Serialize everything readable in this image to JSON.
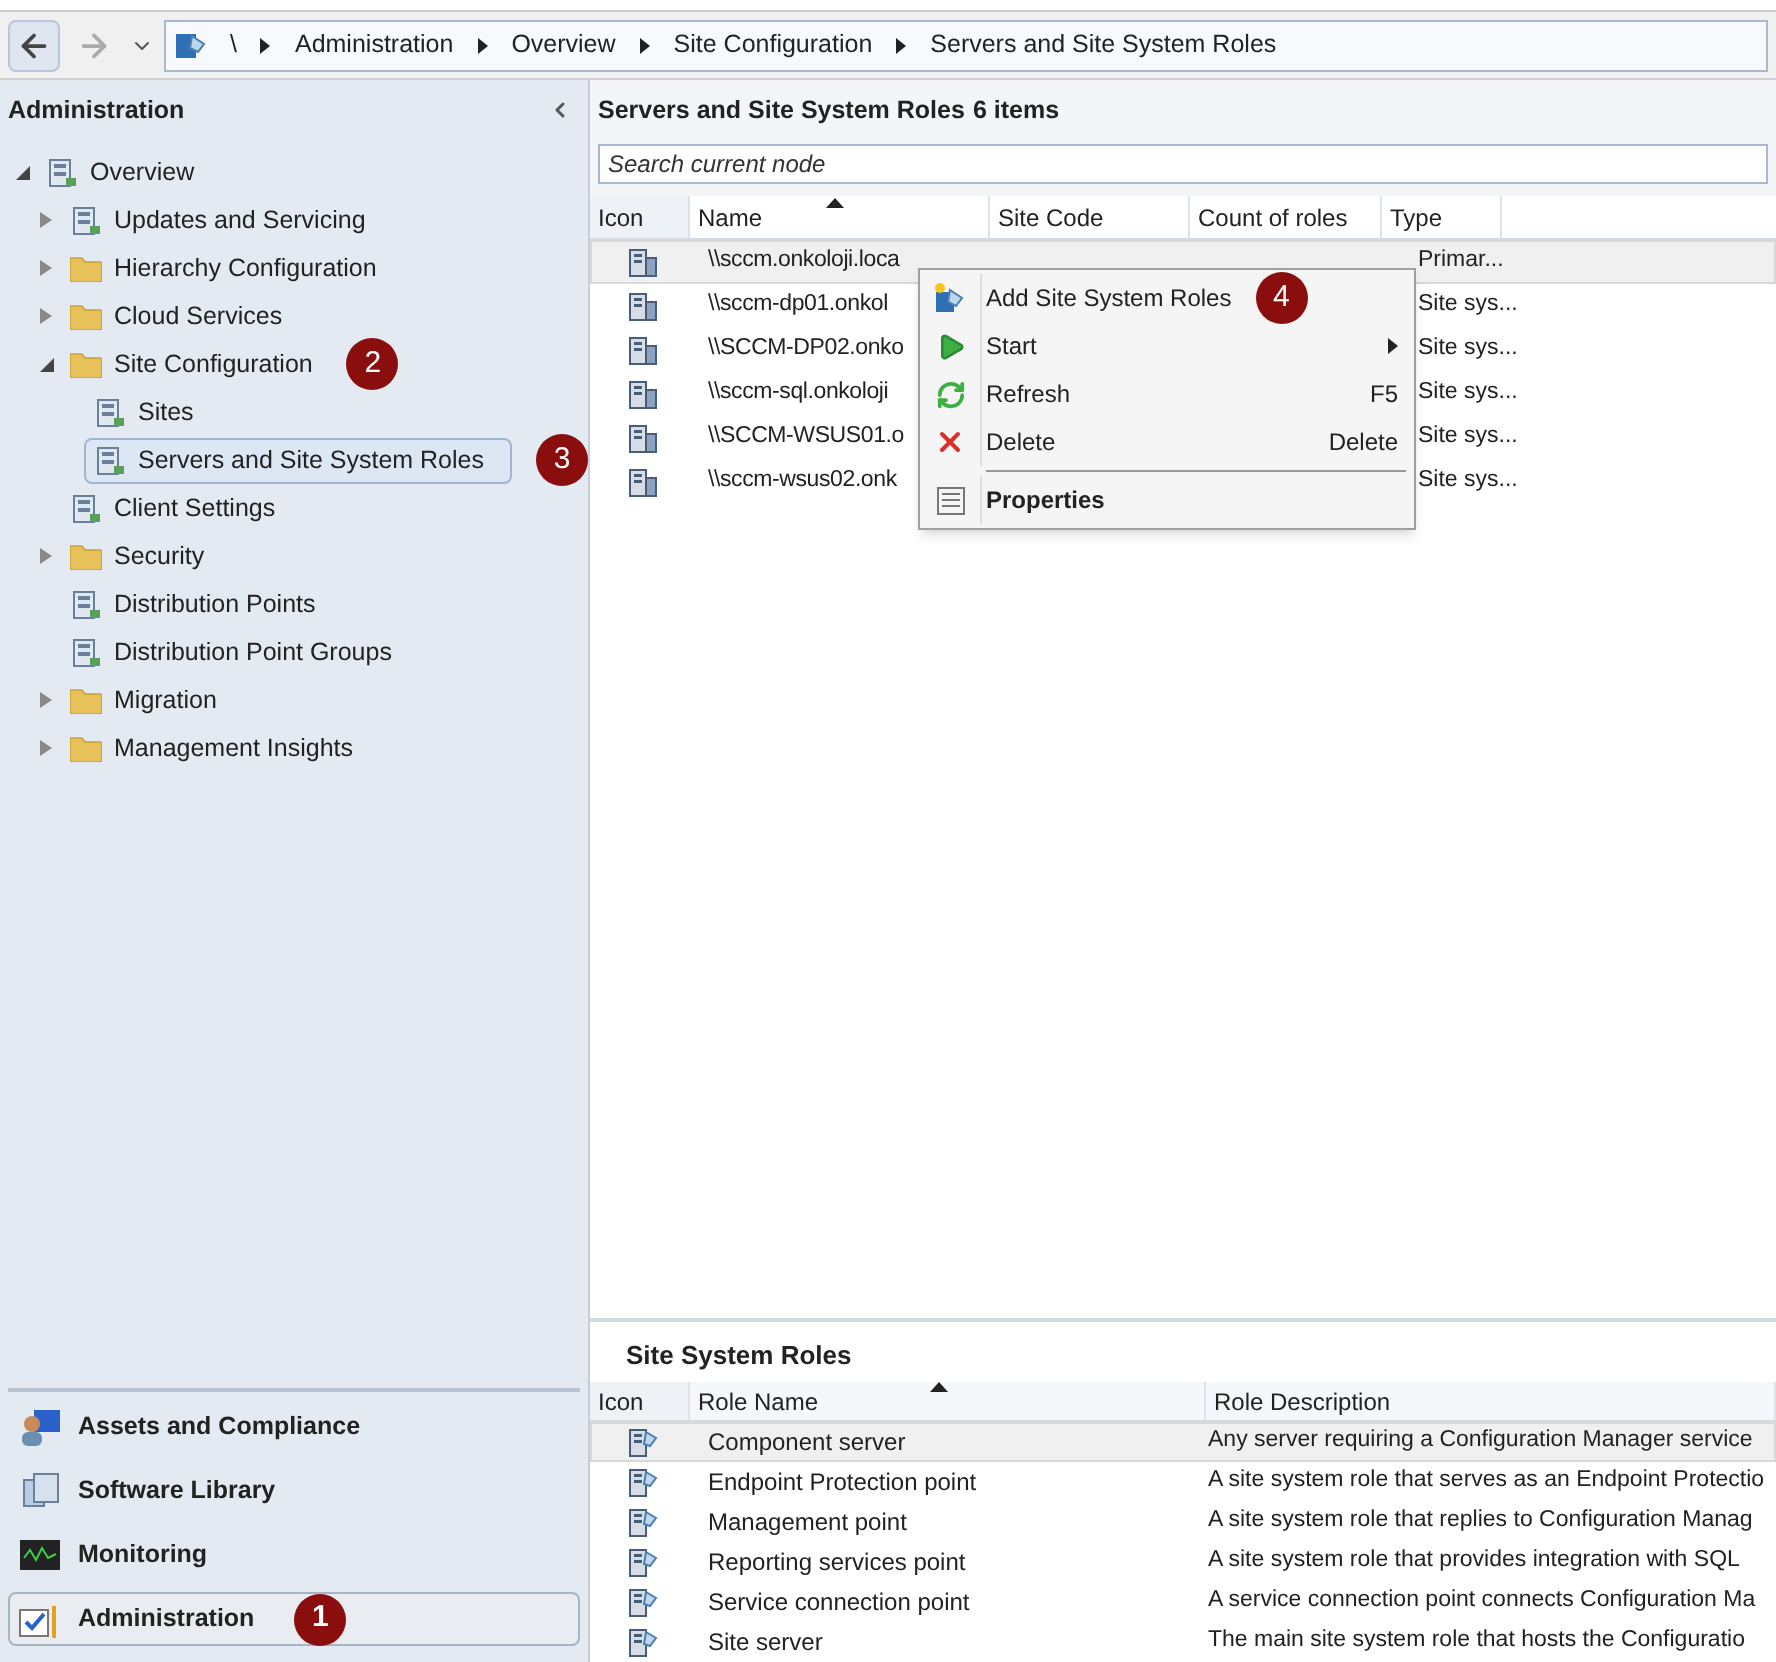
{
  "breadcrumb": [
    "\\",
    "Administration",
    "Overview",
    "Site Configuration",
    "Servers and Site System Roles"
  ],
  "navigation": {
    "title": "Administration",
    "tree": [
      {
        "label": "Overview",
        "kind": "node",
        "expanded": true,
        "selected": false,
        "children": [
          {
            "label": "Updates and Servicing",
            "kind": "node",
            "expanded": false,
            "selected": false
          },
          {
            "label": "Hierarchy Configuration",
            "kind": "folder",
            "expanded": false,
            "selected": false
          },
          {
            "label": "Cloud Services",
            "kind": "folder",
            "expanded": false,
            "selected": false
          },
          {
            "label": "Site Configuration",
            "kind": "folder",
            "expanded": true,
            "selected": false,
            "callout": "2",
            "children": [
              {
                "label": "Sites",
                "kind": "node",
                "selected": false
              },
              {
                "label": "Servers and Site System Roles",
                "kind": "node",
                "selected": true,
                "callout": "3"
              }
            ]
          },
          {
            "label": "Client Settings",
            "kind": "node",
            "selected": false
          },
          {
            "label": "Security",
            "kind": "folder",
            "expanded": false,
            "selected": false
          },
          {
            "label": "Distribution Points",
            "kind": "node",
            "selected": false
          },
          {
            "label": "Distribution Point Groups",
            "kind": "node",
            "selected": false
          },
          {
            "label": "Migration",
            "kind": "folder",
            "expanded": false,
            "selected": false
          },
          {
            "label": "Management Insights",
            "kind": "folder",
            "expanded": false,
            "selected": false
          }
        ]
      }
    ],
    "workspaces": [
      {
        "label": "Assets and Compliance",
        "selected": false
      },
      {
        "label": "Software Library",
        "selected": false
      },
      {
        "label": "Monitoring",
        "selected": false
      },
      {
        "label": "Administration",
        "selected": true,
        "callout": "1"
      }
    ]
  },
  "servers": {
    "title": "Servers and Site System Roles",
    "count": "6 items",
    "search": {
      "placeholder": "Search current node"
    },
    "columns": [
      "Icon",
      "Name",
      "Site Code",
      "Count of roles",
      "Type"
    ],
    "rows": [
      {
        "name": "\\\\sccm.onkoloji.loca",
        "type": "Primar...",
        "selected": true
      },
      {
        "name": "\\\\sccm-dp01.onkol",
        "type": "Site sys...",
        "selected": false
      },
      {
        "name": "\\\\SCCM-DP02.onko",
        "type": "Site sys...",
        "selected": false
      },
      {
        "name": "\\\\sccm-sql.onkoloji",
        "type": "Site sys...",
        "selected": false
      },
      {
        "name": "\\\\SCCM-WSUS01.o",
        "type": "Site sys...",
        "selected": false
      },
      {
        "name": "\\\\sccm-wsus02.onk",
        "type": "Site sys...",
        "selected": false
      }
    ]
  },
  "context_menu": {
    "callout": "4",
    "items": [
      {
        "kind": "item",
        "label": "Add Site System Roles",
        "bold": false,
        "submenu": false
      },
      {
        "kind": "item",
        "label": "Start",
        "bold": false,
        "submenu": true
      },
      {
        "kind": "item",
        "label": "Refresh",
        "shortcut": "F5",
        "bold": false,
        "submenu": false
      },
      {
        "kind": "item",
        "label": "Delete",
        "shortcut": "Delete",
        "bold": false,
        "submenu": false
      },
      {
        "kind": "separator"
      },
      {
        "kind": "item",
        "label": "Properties",
        "bold": true,
        "submenu": false
      }
    ]
  },
  "roles": {
    "title": "Site System Roles",
    "columns": [
      "Icon",
      "Role Name",
      "Role Description"
    ],
    "rows": [
      {
        "name": "Component server",
        "description": "Any server requiring a Configuration Manager service",
        "selected": true
      },
      {
        "name": "Endpoint Protection point",
        "description": "A site system role that serves as an Endpoint Protectio",
        "selected": false
      },
      {
        "name": "Management point",
        "description": "A site system role that replies to Configuration Manag",
        "selected": false
      },
      {
        "name": "Reporting services point",
        "description": "A site system role that  provides integration with SQL",
        "selected": false
      },
      {
        "name": "Service connection point",
        "description": "A service connection point connects Configuration Ma",
        "selected": false
      },
      {
        "name": "Site server",
        "description": "The main site system role that hosts the Configuratio",
        "selected": false
      }
    ]
  }
}
